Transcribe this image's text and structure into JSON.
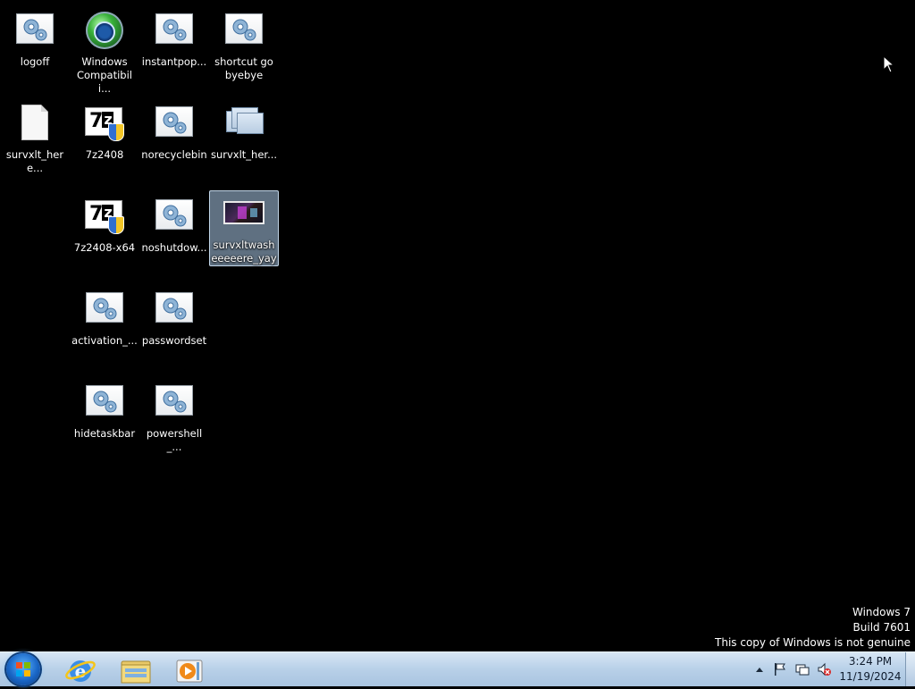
{
  "desktop": {
    "icons": [
      {
        "label": "logoff",
        "type": "script"
      },
      {
        "label": "Windows\nCompatibili...",
        "type": "globe"
      },
      {
        "label": "instantpop...",
        "type": "script"
      },
      {
        "label": "shortcut go\nbyebye",
        "type": "script"
      },
      {
        "label": "survxlt_here...",
        "type": "document"
      },
      {
        "label": "7z2408",
        "type": "installer"
      },
      {
        "label": "norecyclebin",
        "type": "script"
      },
      {
        "label": "survxlt_her...",
        "type": "windows"
      },
      {
        "label": "7z2408-x64",
        "type": "installer"
      },
      {
        "label": "noshutdow...",
        "type": "script"
      },
      {
        "label": "survxltwasheeeeere_yay",
        "type": "video",
        "selected": true
      },
      {
        "label": "activation_...",
        "type": "script"
      },
      {
        "label": "passwordset",
        "type": "script"
      },
      {
        "label": "hidetaskbar",
        "type": "script"
      },
      {
        "label": "powershell_...",
        "type": "script"
      }
    ]
  },
  "watermark": {
    "line1": "Windows 7",
    "line2": "Build 7601",
    "line3": "This copy of Windows is not genuine"
  },
  "taskbar": {
    "start_icon": "windows-logo-icon",
    "pinned": [
      {
        "name": "internet-explorer-icon"
      },
      {
        "name": "windows-explorer-icon"
      },
      {
        "name": "media-player-icon"
      }
    ],
    "tray": {
      "icons": [
        "show-hidden-icons-arrow",
        "action-center-flag-icon",
        "network-icon",
        "volume-muted-icon"
      ],
      "time": "3:24 PM",
      "date": "11/19/2024"
    }
  },
  "colors": {
    "desktop_background": "#000000",
    "taskbar": "#b8d0e8",
    "selection": "#adccEB"
  }
}
